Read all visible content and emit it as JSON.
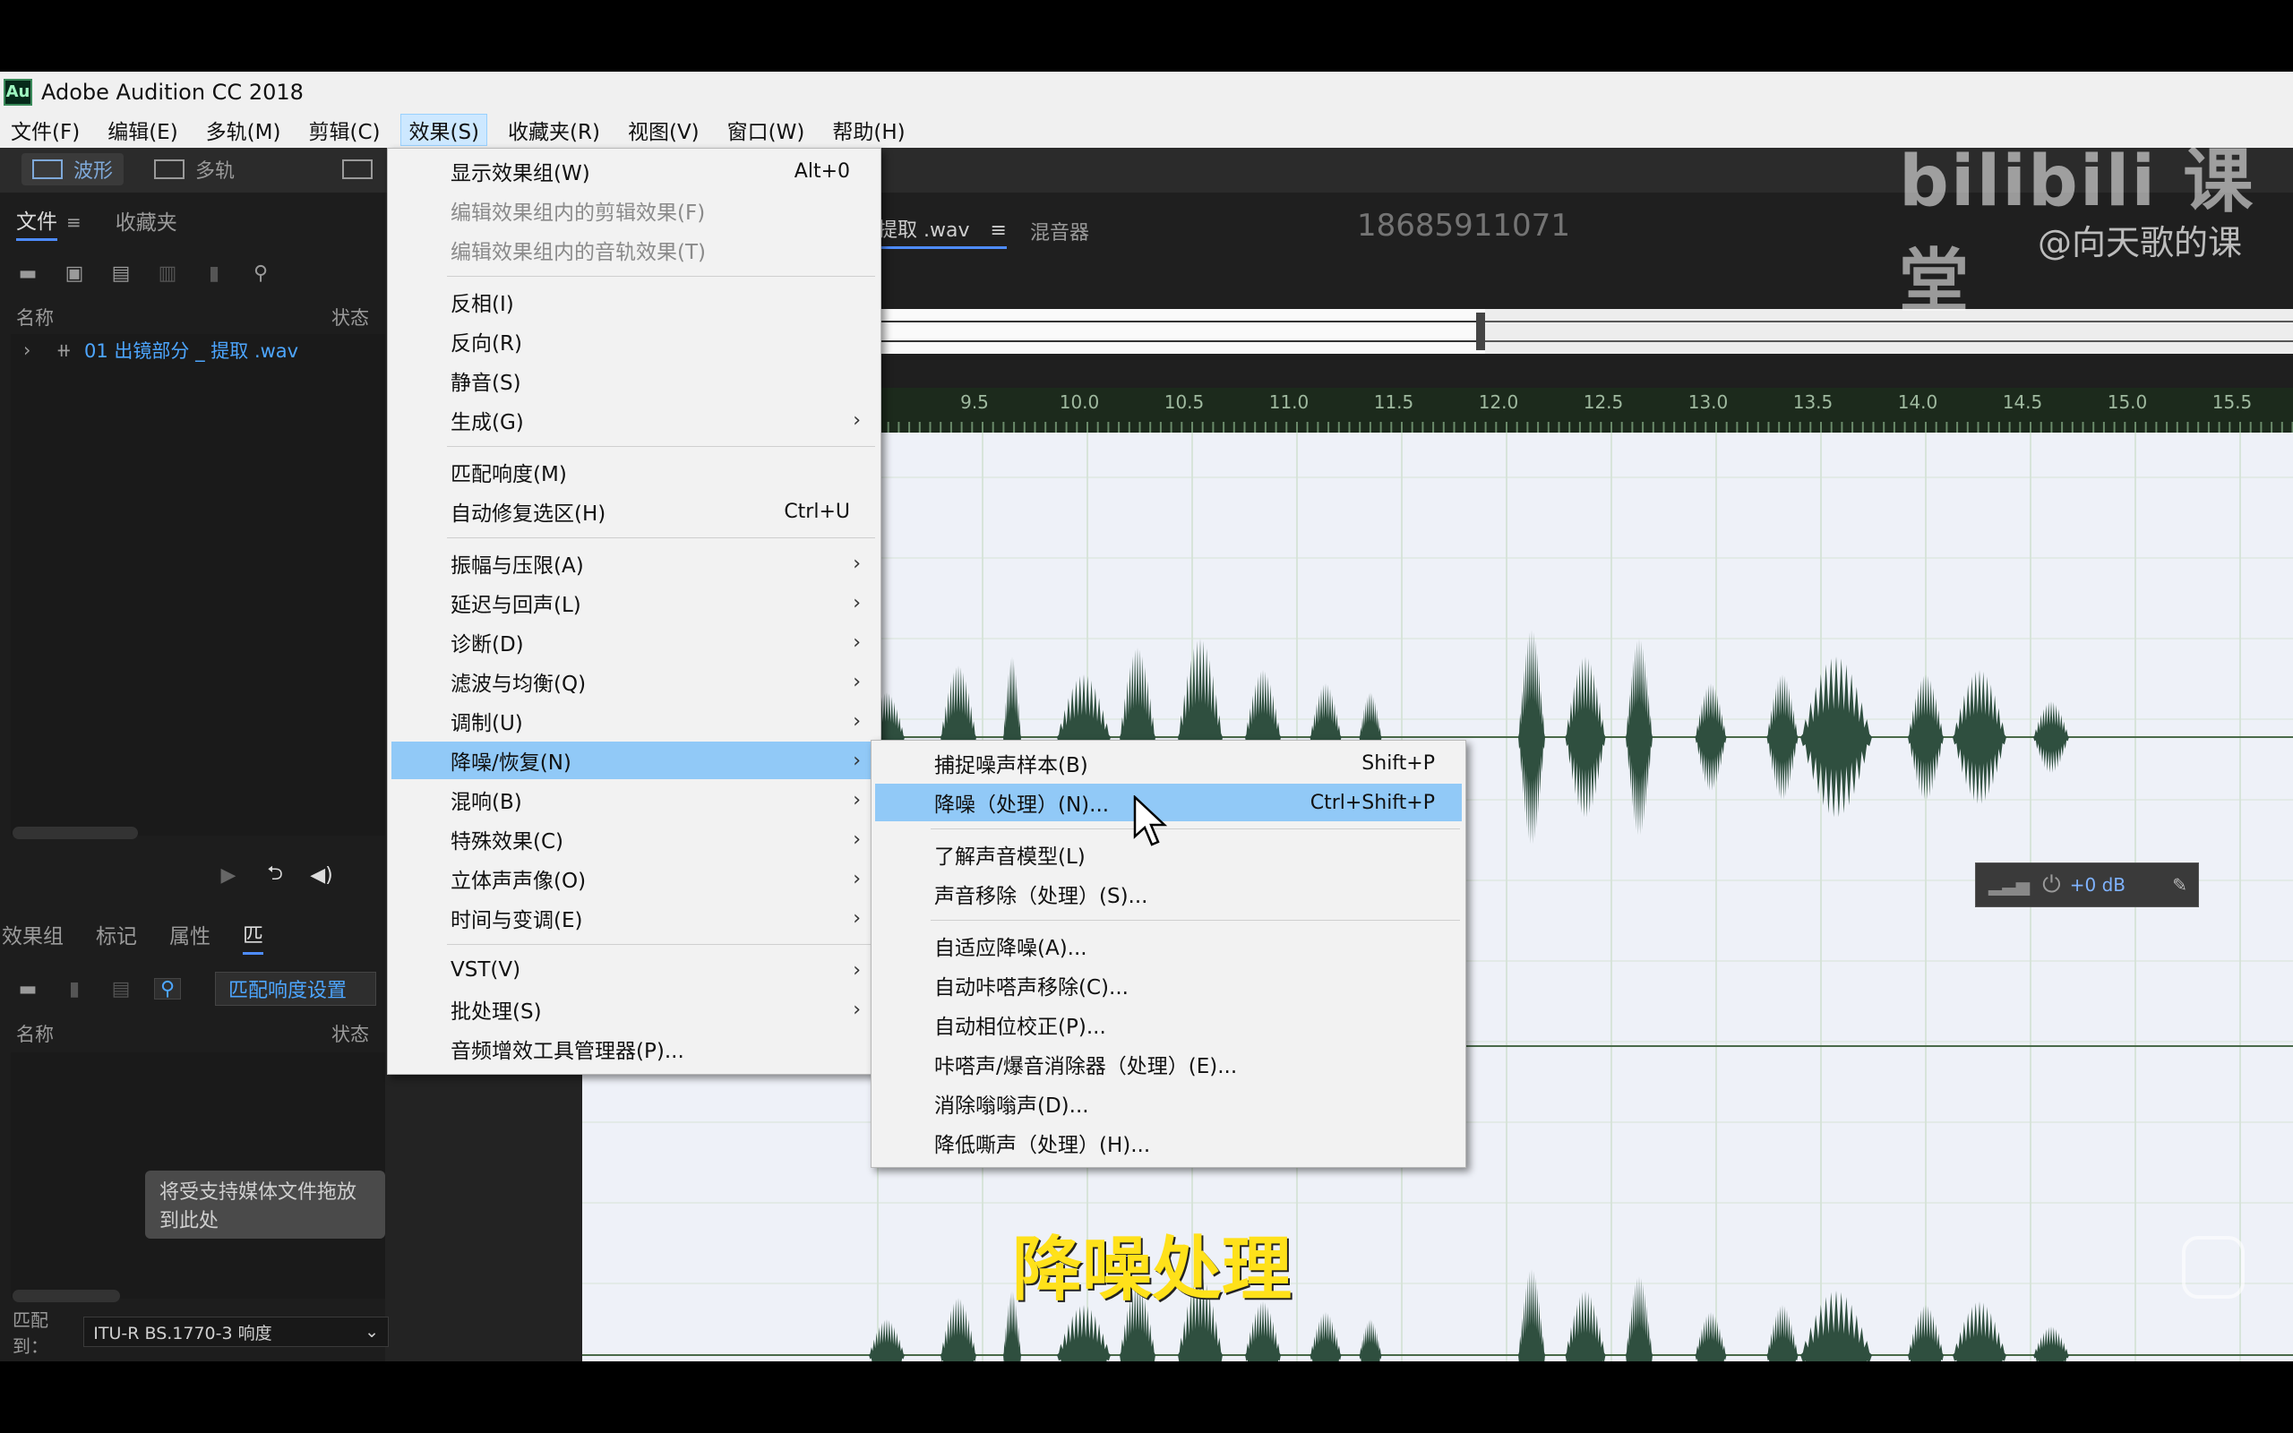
{
  "app": {
    "title": "Adobe Audition CC 2018",
    "icon_text": "Au"
  },
  "menubar": {
    "items": [
      {
        "label": "文件(F)"
      },
      {
        "label": "编辑(E)"
      },
      {
        "label": "多轨(M)"
      },
      {
        "label": "剪辑(C)"
      },
      {
        "label": "效果(S)"
      },
      {
        "label": "收藏夹(R)"
      },
      {
        "label": "视图(V)"
      },
      {
        "label": "窗口(W)"
      },
      {
        "label": "帮助(H)"
      }
    ],
    "active": "效果(S)"
  },
  "toolbar": {
    "waveform_label": "波形",
    "multitrack_label": "多轨"
  },
  "files_panel": {
    "tabs": [
      "文件",
      "收藏夹"
    ],
    "col_name": "名称",
    "col_status": "状态",
    "file_name": "01 出镜部分 _ 提取 .wav"
  },
  "effects_panel": {
    "tabs": [
      "效果组",
      "标记",
      "属性",
      "匹"
    ],
    "match_settings": "匹配响度设置",
    "col_name": "名称",
    "col_status": "状态",
    "drop_hint": "将受支持媒体文件拖放到此处",
    "match_to_label": "匹配到：",
    "match_to_value": "ITU-R BS.1770-3 响度"
  },
  "editor": {
    "tab_file": "提取 .wav",
    "tab_mixer": "混音器",
    "ruler_ticks": [
      "9.5",
      "10.0",
      "10.5",
      "11.0",
      "11.5",
      "12.0",
      "12.5",
      "13.0",
      "13.5",
      "14.0",
      "14.5",
      "15.0",
      "15.5"
    ],
    "hud_value": "+0 dB"
  },
  "effects_menu": {
    "items": [
      {
        "label": "显示效果组(W)",
        "shortcut": "Alt+0",
        "disabled": false,
        "submenu": false
      },
      {
        "label": "编辑效果组内的剪辑效果(F)",
        "shortcut": "",
        "disabled": true,
        "submenu": false
      },
      {
        "label": "编辑效果组内的音轨效果(T)",
        "shortcut": "",
        "disabled": true,
        "submenu": false
      },
      {
        "label": "反相(I)",
        "shortcut": "",
        "disabled": false,
        "submenu": false
      },
      {
        "label": "反向(R)",
        "shortcut": "",
        "disabled": false,
        "submenu": false
      },
      {
        "label": "静音(S)",
        "shortcut": "",
        "disabled": false,
        "submenu": false
      },
      {
        "label": "生成(G)",
        "shortcut": "",
        "disabled": false,
        "submenu": true
      },
      {
        "label": "匹配响度(M)",
        "shortcut": "",
        "disabled": false,
        "submenu": false
      },
      {
        "label": "自动修复选区(H)",
        "shortcut": "Ctrl+U",
        "disabled": false,
        "submenu": false
      },
      {
        "label": "振幅与压限(A)",
        "shortcut": "",
        "disabled": false,
        "submenu": true
      },
      {
        "label": "延迟与回声(L)",
        "shortcut": "",
        "disabled": false,
        "submenu": true
      },
      {
        "label": "诊断(D)",
        "shortcut": "",
        "disabled": false,
        "submenu": true
      },
      {
        "label": "滤波与均衡(Q)",
        "shortcut": "",
        "disabled": false,
        "submenu": true
      },
      {
        "label": "调制(U)",
        "shortcut": "",
        "disabled": false,
        "submenu": true
      },
      {
        "label": "降噪/恢复(N)",
        "shortcut": "",
        "disabled": false,
        "submenu": true,
        "highlighted": true
      },
      {
        "label": "混响(B)",
        "shortcut": "",
        "disabled": false,
        "submenu": true
      },
      {
        "label": "特殊效果(C)",
        "shortcut": "",
        "disabled": false,
        "submenu": true
      },
      {
        "label": "立体声声像(O)",
        "shortcut": "",
        "disabled": false,
        "submenu": true
      },
      {
        "label": "时间与变调(E)",
        "shortcut": "",
        "disabled": false,
        "submenu": true
      },
      {
        "label": "VST(V)",
        "shortcut": "",
        "disabled": false,
        "submenu": true
      },
      {
        "label": "批处理(S)",
        "shortcut": "",
        "disabled": false,
        "submenu": true
      },
      {
        "label": "音频增效工具管理器(P)...",
        "shortcut": "",
        "disabled": false,
        "submenu": false
      }
    ]
  },
  "noise_submenu": {
    "items": [
      {
        "label": "捕捉噪声样本(B)",
        "shortcut": "Shift+P"
      },
      {
        "label": "降噪（处理）(N)...",
        "shortcut": "Ctrl+Shift+P",
        "highlighted": true
      },
      {
        "label": "了解声音模型(L)",
        "shortcut": ""
      },
      {
        "label": "声音移除（处理）(S)...",
        "shortcut": ""
      },
      {
        "label": "自适应降噪(A)...",
        "shortcut": ""
      },
      {
        "label": "自动咔嗒声移除(C)...",
        "shortcut": ""
      },
      {
        "label": "自动相位校正(P)...",
        "shortcut": ""
      },
      {
        "label": "咔嗒声/爆音消除器（处理）(E)...",
        "shortcut": ""
      },
      {
        "label": "消除嗡嗡声(D)...",
        "shortcut": ""
      },
      {
        "label": "降低嘶声（处理）(H)...",
        "shortcut": ""
      }
    ]
  },
  "overlay": {
    "subtitle": "降噪处理",
    "watermark_logo": "bilibili 课堂",
    "watermark_handle": "@向天歌的课",
    "phone": "18685911071"
  },
  "colors": {
    "accent": "#4da6ff",
    "menu_highlight": "#91c9f7",
    "waveform": "#2f4f3f",
    "subtitle": "#ffe11a"
  }
}
